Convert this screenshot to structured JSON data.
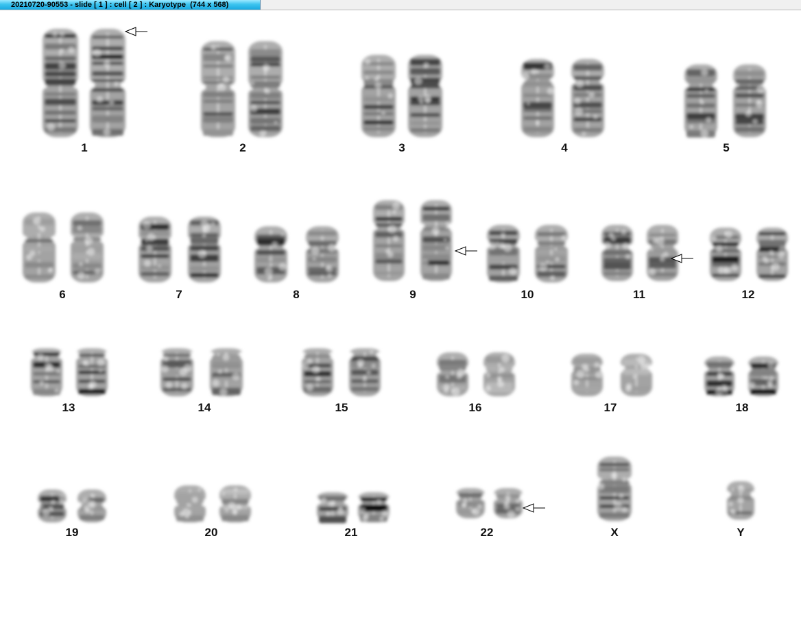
{
  "window": {
    "title": "20210720-90553 - slide [ 1 ] : cell [ 2 ] : Karyotype  (744 x 568)"
  },
  "karyotype": {
    "chromosomes": [
      {
        "label": "1",
        "marked": true
      },
      {
        "label": "2",
        "marked": false
      },
      {
        "label": "3",
        "marked": false
      },
      {
        "label": "4",
        "marked": false
      },
      {
        "label": "5",
        "marked": false
      },
      {
        "label": "6",
        "marked": false
      },
      {
        "label": "7",
        "marked": false
      },
      {
        "label": "8",
        "marked": false
      },
      {
        "label": "9",
        "marked": true
      },
      {
        "label": "10",
        "marked": false
      },
      {
        "label": "11",
        "marked": true
      },
      {
        "label": "12",
        "marked": false
      },
      {
        "label": "13",
        "marked": false
      },
      {
        "label": "14",
        "marked": false
      },
      {
        "label": "15",
        "marked": false
      },
      {
        "label": "16",
        "marked": false
      },
      {
        "label": "17",
        "marked": false
      },
      {
        "label": "18",
        "marked": false
      },
      {
        "label": "19",
        "marked": false
      },
      {
        "label": "20",
        "marked": false
      },
      {
        "label": "21",
        "marked": false
      },
      {
        "label": "22",
        "marked": true
      },
      {
        "label": "X",
        "marked": false
      },
      {
        "label": "Y",
        "marked": false
      }
    ]
  }
}
